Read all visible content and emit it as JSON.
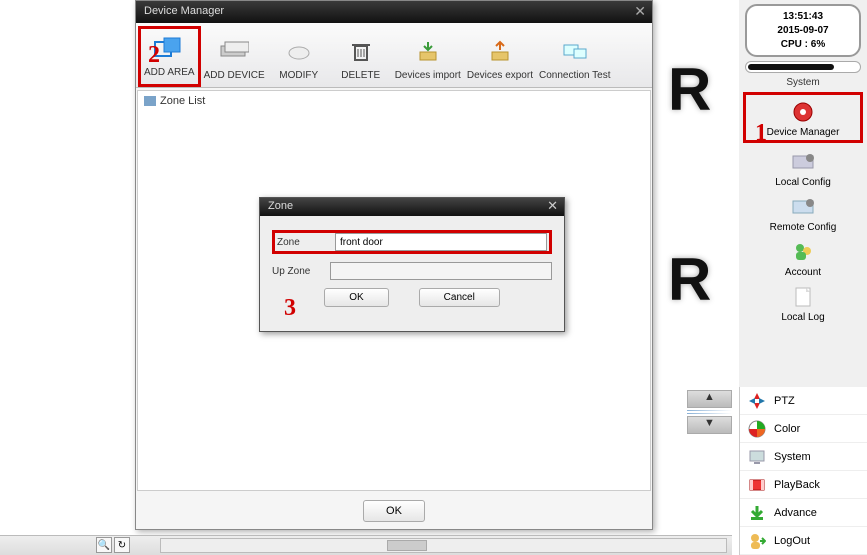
{
  "device_manager": {
    "title": "Device Manager",
    "toolbar": [
      {
        "label": "ADD AREA",
        "icon": "add-area-icon"
      },
      {
        "label": "ADD DEVICE",
        "icon": "add-device-icon"
      },
      {
        "label": "MODIFY",
        "icon": "modify-icon"
      },
      {
        "label": "DELETE",
        "icon": "delete-icon"
      },
      {
        "label": "Devices import",
        "icon": "import-icon"
      },
      {
        "label": "Devices export",
        "icon": "export-icon"
      },
      {
        "label": "Connection Test",
        "icon": "connection-test-icon"
      }
    ],
    "zone_list_label": "Zone List",
    "footer_ok": "OK"
  },
  "zone_dialog": {
    "title": "Zone",
    "field_zone_label": "Zone",
    "field_zone_value": "front door",
    "field_upzone_label": "Up Zone",
    "field_upzone_value": "",
    "ok": "OK",
    "cancel": "Cancel"
  },
  "sidebar": {
    "clock": {
      "time": "13:51:43",
      "date": "2015-09-07",
      "cpu": "CPU : 6%"
    },
    "system_label": "System",
    "buttons": [
      {
        "label": "Device Manager",
        "icon": "device-manager-icon"
      },
      {
        "label": "Local Config",
        "icon": "local-config-icon"
      },
      {
        "label": "Remote Config",
        "icon": "remote-config-icon"
      },
      {
        "label": "Account",
        "icon": "account-icon"
      },
      {
        "label": "Local Log",
        "icon": "local-log-icon"
      }
    ],
    "menu2": [
      {
        "label": "PTZ",
        "icon": "ptz-icon"
      },
      {
        "label": "Color",
        "icon": "color-icon"
      },
      {
        "label": "System",
        "icon": "system-icon"
      },
      {
        "label": "PlayBack",
        "icon": "playback-icon"
      },
      {
        "label": "Advance",
        "icon": "advance-icon"
      },
      {
        "label": "LogOut",
        "icon": "logout-icon"
      }
    ]
  },
  "annotations": {
    "a1": "1",
    "a2": "2",
    "a3": "3"
  }
}
